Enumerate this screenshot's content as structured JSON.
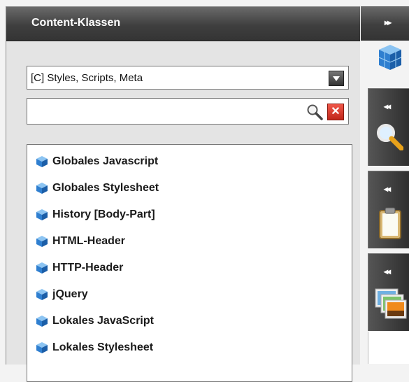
{
  "panel": {
    "title": "Content-Klassen"
  },
  "filter": {
    "selected": "[C] Styles, Scripts, Meta"
  },
  "search": {
    "value": "",
    "placeholder": ""
  },
  "list": {
    "items": [
      {
        "label": "Globales Javascript"
      },
      {
        "label": "Globales Stylesheet"
      },
      {
        "label": "History [Body-Part]"
      },
      {
        "label": "HTML-Header"
      },
      {
        "label": "HTTP-Header"
      },
      {
        "label": "jQuery"
      },
      {
        "label": "Lokales JavaScript"
      },
      {
        "label": "Lokales Stylesheet"
      }
    ]
  },
  "rail": {
    "expand_glyph": "▸▸",
    "collapse_glyph": "◂◂",
    "tabs": [
      {
        "icon": "magnifier-icon"
      },
      {
        "icon": "clipboard-icon"
      },
      {
        "icon": "images-icon"
      }
    ]
  },
  "colors": {
    "header_dark": "#3f3f3f",
    "panel_bg": "#e4e4e4",
    "cube_blue": "#2f7fd0"
  }
}
